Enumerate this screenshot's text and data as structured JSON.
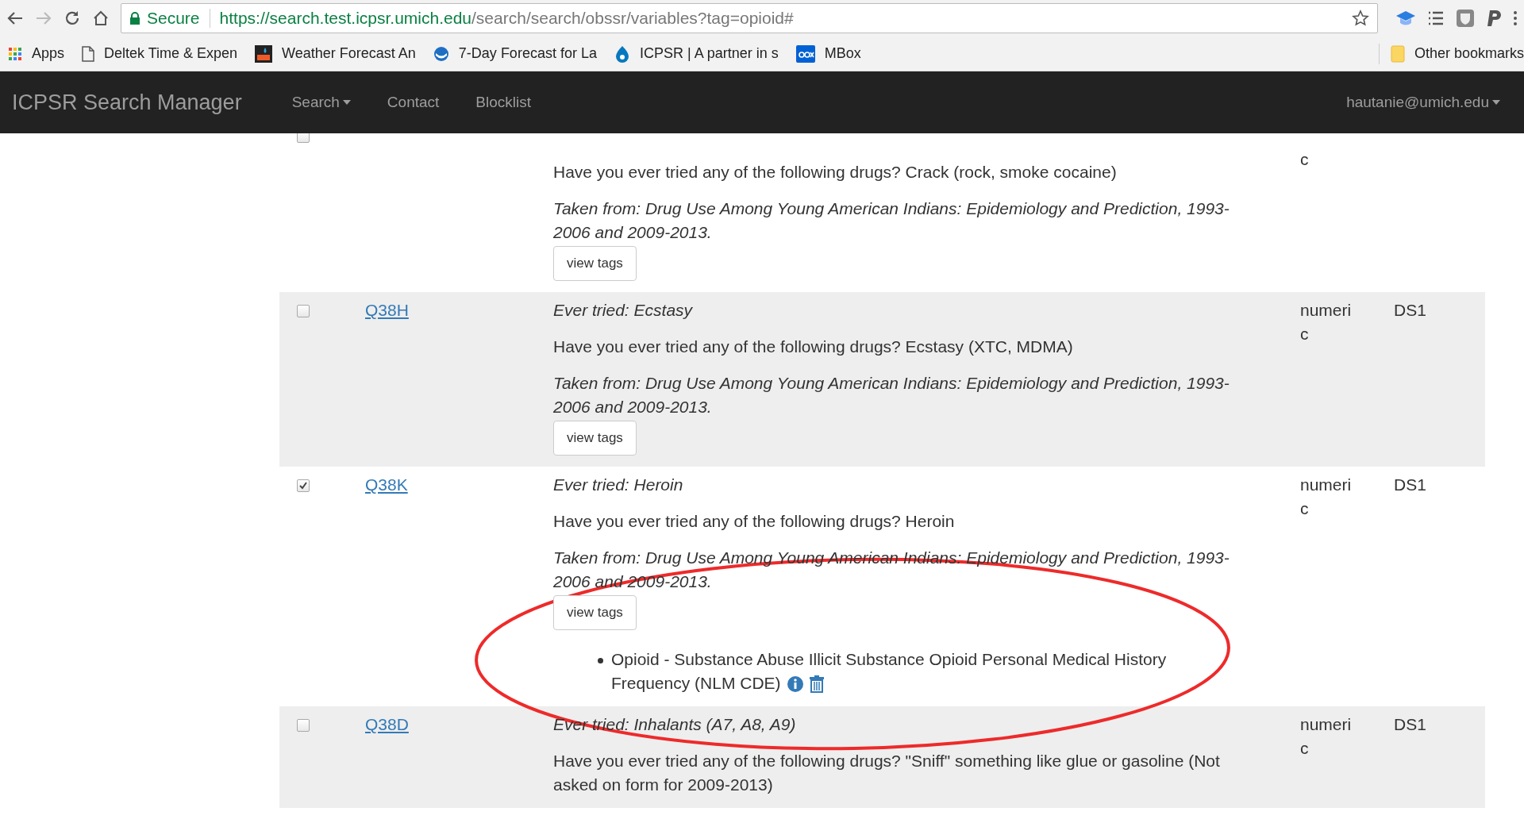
{
  "browser": {
    "address": {
      "secure_label": "Secure",
      "url_host": "https://search.test.icpsr.umich.edu",
      "url_path": "/search/search/obssr/variables?tag=opioid#"
    },
    "bookmarks": [
      {
        "kind": "apps",
        "label": "Apps"
      },
      {
        "kind": "page",
        "label": "Deltek Time & Expen"
      },
      {
        "kind": "wu",
        "label": "Weather Forecast An"
      },
      {
        "kind": "noaa",
        "label": "7-Day Forecast for La"
      },
      {
        "kind": "drupal",
        "label": "ICPSR | A partner in s"
      },
      {
        "kind": "box",
        "label": "MBox"
      }
    ],
    "other_bookmarks": "Other bookmarks"
  },
  "navbar": {
    "brand": "ICPSR Search Manager",
    "menu": [
      {
        "label": "Search",
        "dropdown": true
      },
      {
        "label": "Contact",
        "dropdown": false
      },
      {
        "label": "Blocklist",
        "dropdown": false
      }
    ],
    "user": {
      "label": "hautanie@umich.edu",
      "dropdown": true
    }
  },
  "rows": [
    {
      "checked": false,
      "description": "Have you ever tried any of the following drugs? Crack (rock, smoke cocaine)",
      "source": "Taken from: Drug Use Among Young American Indians: Epidemiology and Prediction, 1993-2006 and 2009-2013.",
      "button": "view tags",
      "type": "c"
    },
    {
      "checked": false,
      "code": "Q38H",
      "title": "Ever tried: Ecstasy",
      "description": "Have you ever tried any of the following drugs? Ecstasy (XTC, MDMA)",
      "source": "Taken from: Drug Use Among Young American Indians: Epidemiology and Prediction, 1993-2006 and 2009-2013.",
      "button": "view tags",
      "type": "numeric",
      "dataset": "DS1"
    },
    {
      "checked": true,
      "code": "Q38K",
      "title": "Ever tried: Heroin",
      "description": "Have you ever tried any of the following drugs? Heroin",
      "source": "Taken from: Drug Use Among Young American Indians: Epidemiology and Prediction, 1993-2006 and 2009-2013.",
      "button": "view tags",
      "tags": [
        "Opioid - Substance Abuse Illicit Substance Opioid Personal Medical History Frequency (NLM CDE)"
      ],
      "type": "numeric",
      "dataset": "DS1"
    },
    {
      "checked": false,
      "code": "Q38D",
      "title": "Ever tried: Inhalants (A7, A8, A9)",
      "description": "Have you ever tried any of the following drugs? \"Sniff\" something like glue or gasoline (Not asked on form for 2009-2013)",
      "type": "numeric",
      "dataset": "DS1"
    }
  ]
}
